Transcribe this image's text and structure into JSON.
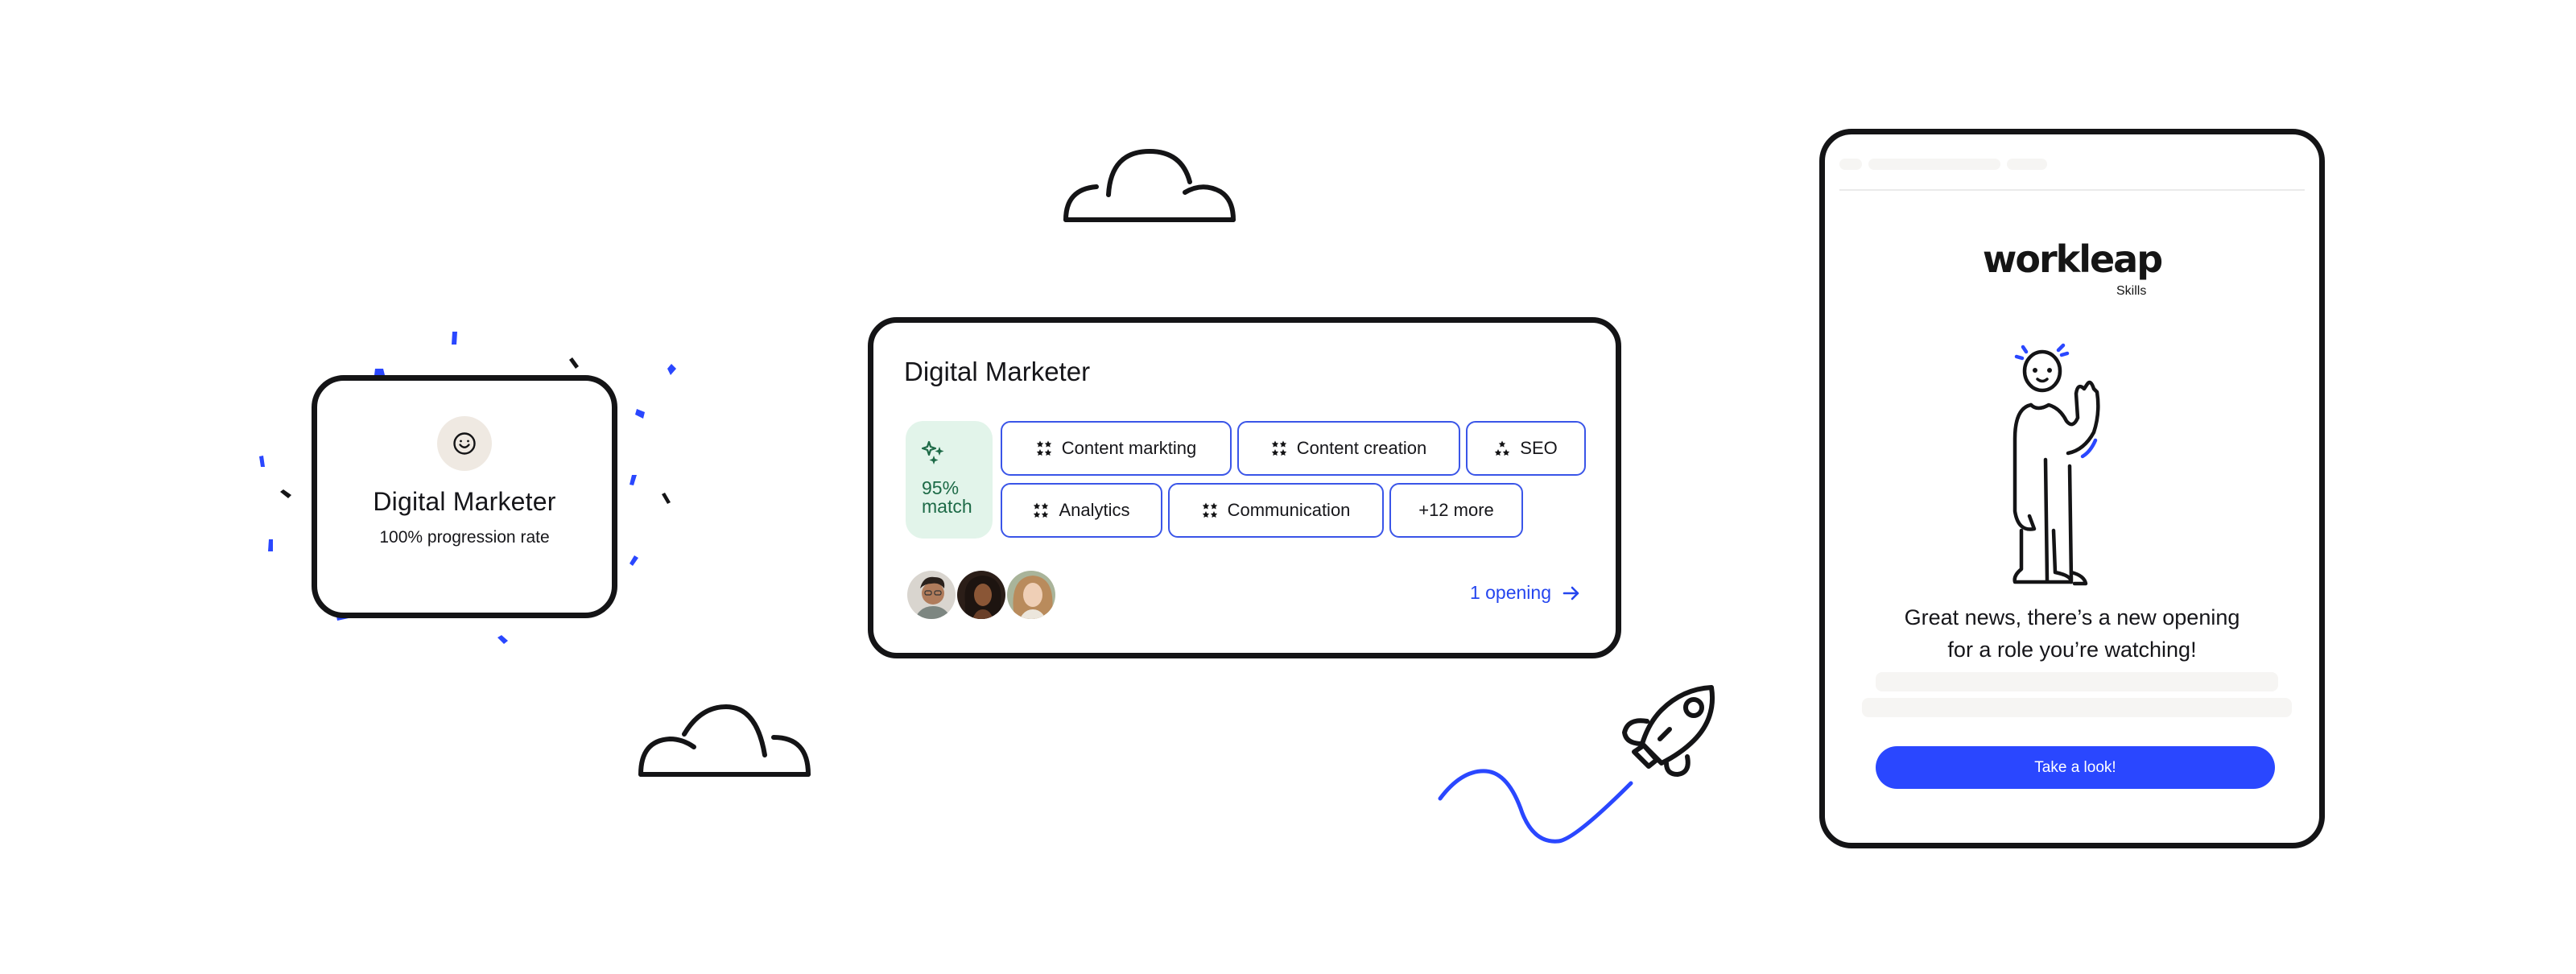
{
  "colors": {
    "accent": "#2a47ff",
    "ink": "#141416",
    "match_bg": "#e2f4ea",
    "match_fg": "#1d6a47",
    "avatar_bg": "#efe9e2"
  },
  "achievement_card": {
    "icon": "smiley-icon",
    "title": "Digital Marketer",
    "subtitle": "100% progression rate"
  },
  "role_card": {
    "title": "Digital Marketer",
    "match": {
      "icon": "sparkles-icon",
      "percent_label": "95%",
      "label": "match"
    },
    "skills": [
      {
        "label": "Content markting",
        "icon": "four-stars-icon"
      },
      {
        "label": "Content creation",
        "icon": "four-stars-icon"
      },
      {
        "label": "SEO",
        "icon": "three-stars-icon"
      },
      {
        "label": "Analytics",
        "icon": "four-stars-icon"
      },
      {
        "label": "Communication",
        "icon": "four-stars-icon"
      }
    ],
    "more_label": "+12 more",
    "avatars": [
      "person-1",
      "person-2",
      "person-3"
    ],
    "openings_link": "1 opening"
  },
  "notification": {
    "brand": "workleap",
    "product": "Skills",
    "message_line1": "Great news, there’s a new opening",
    "message_line2": "for a role you’re watching!",
    "cta_label": "Take a look!"
  }
}
